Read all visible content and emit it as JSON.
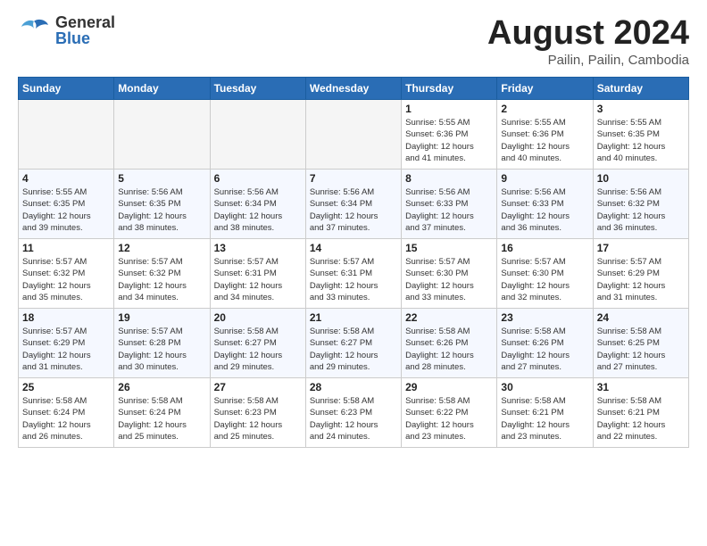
{
  "logo": {
    "general": "General",
    "blue": "Blue"
  },
  "header": {
    "month": "August 2024",
    "location": "Pailin, Pailin, Cambodia"
  },
  "weekdays": [
    "Sunday",
    "Monday",
    "Tuesday",
    "Wednesday",
    "Thursday",
    "Friday",
    "Saturday"
  ],
  "weeks": [
    [
      {
        "day": "",
        "info": ""
      },
      {
        "day": "",
        "info": ""
      },
      {
        "day": "",
        "info": ""
      },
      {
        "day": "",
        "info": ""
      },
      {
        "day": "1",
        "info": "Sunrise: 5:55 AM\nSunset: 6:36 PM\nDaylight: 12 hours\nand 41 minutes."
      },
      {
        "day": "2",
        "info": "Sunrise: 5:55 AM\nSunset: 6:36 PM\nDaylight: 12 hours\nand 40 minutes."
      },
      {
        "day": "3",
        "info": "Sunrise: 5:55 AM\nSunset: 6:35 PM\nDaylight: 12 hours\nand 40 minutes."
      }
    ],
    [
      {
        "day": "4",
        "info": "Sunrise: 5:55 AM\nSunset: 6:35 PM\nDaylight: 12 hours\nand 39 minutes."
      },
      {
        "day": "5",
        "info": "Sunrise: 5:56 AM\nSunset: 6:35 PM\nDaylight: 12 hours\nand 38 minutes."
      },
      {
        "day": "6",
        "info": "Sunrise: 5:56 AM\nSunset: 6:34 PM\nDaylight: 12 hours\nand 38 minutes."
      },
      {
        "day": "7",
        "info": "Sunrise: 5:56 AM\nSunset: 6:34 PM\nDaylight: 12 hours\nand 37 minutes."
      },
      {
        "day": "8",
        "info": "Sunrise: 5:56 AM\nSunset: 6:33 PM\nDaylight: 12 hours\nand 37 minutes."
      },
      {
        "day": "9",
        "info": "Sunrise: 5:56 AM\nSunset: 6:33 PM\nDaylight: 12 hours\nand 36 minutes."
      },
      {
        "day": "10",
        "info": "Sunrise: 5:56 AM\nSunset: 6:32 PM\nDaylight: 12 hours\nand 36 minutes."
      }
    ],
    [
      {
        "day": "11",
        "info": "Sunrise: 5:57 AM\nSunset: 6:32 PM\nDaylight: 12 hours\nand 35 minutes."
      },
      {
        "day": "12",
        "info": "Sunrise: 5:57 AM\nSunset: 6:32 PM\nDaylight: 12 hours\nand 34 minutes."
      },
      {
        "day": "13",
        "info": "Sunrise: 5:57 AM\nSunset: 6:31 PM\nDaylight: 12 hours\nand 34 minutes."
      },
      {
        "day": "14",
        "info": "Sunrise: 5:57 AM\nSunset: 6:31 PM\nDaylight: 12 hours\nand 33 minutes."
      },
      {
        "day": "15",
        "info": "Sunrise: 5:57 AM\nSunset: 6:30 PM\nDaylight: 12 hours\nand 33 minutes."
      },
      {
        "day": "16",
        "info": "Sunrise: 5:57 AM\nSunset: 6:30 PM\nDaylight: 12 hours\nand 32 minutes."
      },
      {
        "day": "17",
        "info": "Sunrise: 5:57 AM\nSunset: 6:29 PM\nDaylight: 12 hours\nand 31 minutes."
      }
    ],
    [
      {
        "day": "18",
        "info": "Sunrise: 5:57 AM\nSunset: 6:29 PM\nDaylight: 12 hours\nand 31 minutes."
      },
      {
        "day": "19",
        "info": "Sunrise: 5:57 AM\nSunset: 6:28 PM\nDaylight: 12 hours\nand 30 minutes."
      },
      {
        "day": "20",
        "info": "Sunrise: 5:58 AM\nSunset: 6:27 PM\nDaylight: 12 hours\nand 29 minutes."
      },
      {
        "day": "21",
        "info": "Sunrise: 5:58 AM\nSunset: 6:27 PM\nDaylight: 12 hours\nand 29 minutes."
      },
      {
        "day": "22",
        "info": "Sunrise: 5:58 AM\nSunset: 6:26 PM\nDaylight: 12 hours\nand 28 minutes."
      },
      {
        "day": "23",
        "info": "Sunrise: 5:58 AM\nSunset: 6:26 PM\nDaylight: 12 hours\nand 27 minutes."
      },
      {
        "day": "24",
        "info": "Sunrise: 5:58 AM\nSunset: 6:25 PM\nDaylight: 12 hours\nand 27 minutes."
      }
    ],
    [
      {
        "day": "25",
        "info": "Sunrise: 5:58 AM\nSunset: 6:24 PM\nDaylight: 12 hours\nand 26 minutes."
      },
      {
        "day": "26",
        "info": "Sunrise: 5:58 AM\nSunset: 6:24 PM\nDaylight: 12 hours\nand 25 minutes."
      },
      {
        "day": "27",
        "info": "Sunrise: 5:58 AM\nSunset: 6:23 PM\nDaylight: 12 hours\nand 25 minutes."
      },
      {
        "day": "28",
        "info": "Sunrise: 5:58 AM\nSunset: 6:23 PM\nDaylight: 12 hours\nand 24 minutes."
      },
      {
        "day": "29",
        "info": "Sunrise: 5:58 AM\nSunset: 6:22 PM\nDaylight: 12 hours\nand 23 minutes."
      },
      {
        "day": "30",
        "info": "Sunrise: 5:58 AM\nSunset: 6:21 PM\nDaylight: 12 hours\nand 23 minutes."
      },
      {
        "day": "31",
        "info": "Sunrise: 5:58 AM\nSunset: 6:21 PM\nDaylight: 12 hours\nand 22 minutes."
      }
    ]
  ]
}
